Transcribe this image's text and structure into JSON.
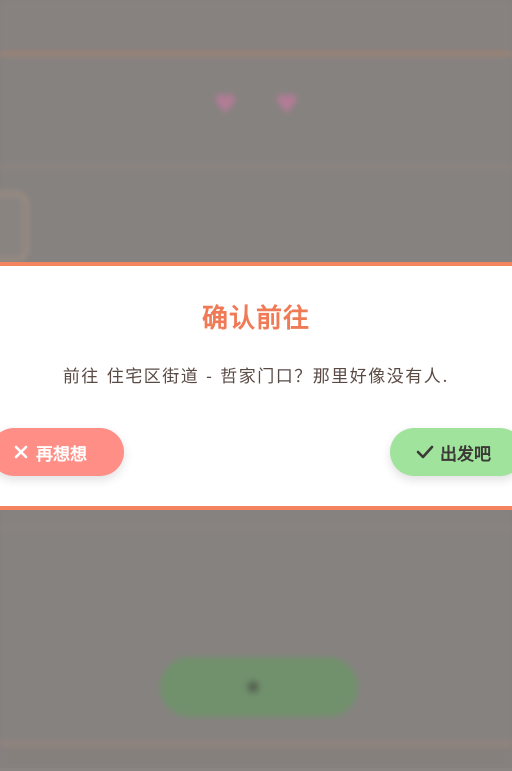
{
  "background": {
    "title": "",
    "action_button_label": ""
  },
  "dialog": {
    "title": "确认前往",
    "message": "前往 住宅区街道 - 哲家门口？那里好像没有人.",
    "cancel_label": "再想想",
    "confirm_label": "出发吧"
  },
  "colors": {
    "accent": "#f3845f",
    "cancel": "#ff8f86",
    "confirm": "#9fe39c",
    "text": "#5a4a44"
  },
  "icons": {
    "cancel": "close-icon",
    "confirm": "check-icon"
  }
}
